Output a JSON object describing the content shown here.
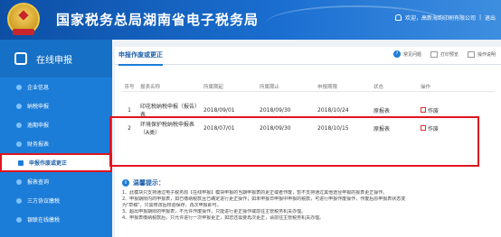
{
  "header": {
    "title": "国家税务总局湖南省电子税务局",
    "user_text": "欢迎，高新海韵印刷有限公司",
    "logout": "退出"
  },
  "sidebar": {
    "title": "在线申报",
    "items": [
      {
        "label": "企业信息"
      },
      {
        "label": "纳税申报"
      },
      {
        "label": "逾期申报"
      },
      {
        "label": "财务报表"
      },
      {
        "label": "申报作废或更正",
        "active": true
      },
      {
        "label": "报表查询"
      },
      {
        "label": "三方协议缴税"
      },
      {
        "label": "银联在线缴税"
      }
    ]
  },
  "main": {
    "tab": "申报作废或更正",
    "tools": [
      "常见问题",
      "打印预览",
      "操作说明"
    ],
    "columns": [
      "序号",
      "报表名称",
      "所属期起",
      "所属期止",
      "申报期限",
      "状态",
      "操作"
    ],
    "rows": [
      {
        "no": "1",
        "name": "印花税纳税申报（报告）表",
        "start": "2018/09/01",
        "end": "2018/09/30",
        "due": "2018/10/24",
        "state": "原报表",
        "op": "作废"
      },
      {
        "no": "2",
        "name": "环境保护税纳税申报表（A类）",
        "start": "2018/07/01",
        "end": "2018/09/30",
        "due": "2018/10/15",
        "state": "原报表",
        "op": "作废"
      }
    ],
    "tip_title": "温馨提示：",
    "tips": [
      "1、此模块只支持通过电子税务局【在线申报】模块申报的当期申报表的更正或者作废，暂不支持通过其他途径申报的报表更正操作。",
      "2、申报期限内的申报表，如已缴纳税款且已确定进行更正操作；如未申报日申报中申报的税款，可进行申报作废操作，作废后原申报表状态变",
      "   为\"草稿\"，只需修改后校验保存，再次申报即可。",
      "3、超出申报期限的申报表，不允许作废操作，只能进行更正操作或前往主管税务机关办理。",
      "4、申报表缴纳税款后，只允许进行一次申报更正，如您还需要再次更正，请前往主管税务机关办理。"
    ]
  }
}
